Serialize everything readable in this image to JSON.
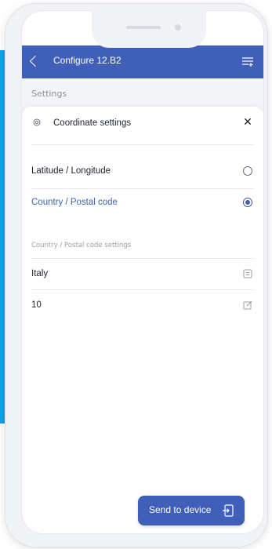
{
  "colors": {
    "brand": "#3f5fb8",
    "accent_blue": "#1aa0e8",
    "text_dark": "#1f2430",
    "text_muted": "#8a8f99"
  },
  "header": {
    "title": "Configure 12.B2",
    "back_icon": "chevron-left-icon",
    "menu_icon": "filter-list-icon"
  },
  "settings_label": "Settings",
  "panel": {
    "title": "Coordinate settings",
    "pin_icon": "location-pin-icon",
    "close_icon": "close-icon",
    "close_glyph": "✕",
    "options": [
      {
        "label": "Latitude / Longitude",
        "selected": false
      },
      {
        "label": "Country / Postal code",
        "selected": true
      }
    ],
    "section_caption": "Country / Postal code settings",
    "fields": [
      {
        "value": "Italy",
        "icon": "list-icon"
      },
      {
        "value": "10",
        "icon": "edit-icon"
      }
    ]
  },
  "send_button": {
    "label": "Send to device",
    "icon": "send-to-device-icon"
  }
}
